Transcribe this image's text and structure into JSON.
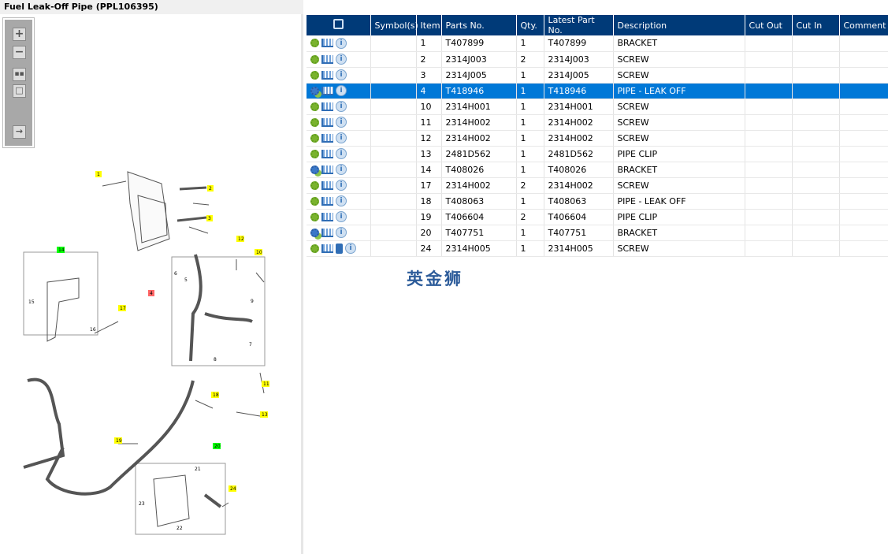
{
  "title": "Fuel Leak-Off Pipe (PPL106395)",
  "toolbar": {
    "zoom_in": "zoom-in",
    "zoom_out": "zoom-out",
    "fit": "fit-all",
    "reset": "actual-size",
    "export": "list-export"
  },
  "columns": [
    "",
    "Symbol(s)",
    "Item",
    "Parts No.",
    "Qty.",
    "Latest Part No.",
    "Description",
    "Cut Out",
    "Cut In",
    "Comment"
  ],
  "rows": [
    {
      "item": "1",
      "part": "T407899",
      "qty": "1",
      "latest": "T407899",
      "desc": "BRACKET",
      "icon": "green-gear"
    },
    {
      "item": "2",
      "part": "2314J003",
      "qty": "2",
      "latest": "2314J003",
      "desc": "SCREW",
      "icon": "green-gear"
    },
    {
      "item": "3",
      "part": "2314J005",
      "qty": "1",
      "latest": "2314J005",
      "desc": "SCREW",
      "icon": "green-gear"
    },
    {
      "item": "4",
      "part": "T418946",
      "qty": "1",
      "latest": "T418946",
      "desc": "PIPE - LEAK OFF",
      "icon": "blue-gear",
      "selected": true
    },
    {
      "item": "10",
      "part": "2314H001",
      "qty": "1",
      "latest": "2314H001",
      "desc": "SCREW",
      "icon": "green-gear"
    },
    {
      "item": "11",
      "part": "2314H002",
      "qty": "1",
      "latest": "2314H002",
      "desc": "SCREW",
      "icon": "green-gear"
    },
    {
      "item": "12",
      "part": "2314H002",
      "qty": "1",
      "latest": "2314H002",
      "desc": "SCREW",
      "icon": "green-gear"
    },
    {
      "item": "13",
      "part": "2481D562",
      "qty": "1",
      "latest": "2481D562",
      "desc": "PIPE CLIP",
      "icon": "green-gear"
    },
    {
      "item": "14",
      "part": "T408026",
      "qty": "1",
      "latest": "T408026",
      "desc": "BRACKET",
      "icon": "blue-gear"
    },
    {
      "item": "17",
      "part": "2314H002",
      "qty": "2",
      "latest": "2314H002",
      "desc": "SCREW",
      "icon": "green-gear"
    },
    {
      "item": "18",
      "part": "T408063",
      "qty": "1",
      "latest": "T408063",
      "desc": "PIPE - LEAK OFF",
      "icon": "green-gear"
    },
    {
      "item": "19",
      "part": "T406604",
      "qty": "2",
      "latest": "T406604",
      "desc": "PIPE CLIP",
      "icon": "green-gear"
    },
    {
      "item": "20",
      "part": "T407751",
      "qty": "1",
      "latest": "T407751",
      "desc": "BRACKET",
      "icon": "blue-gear"
    },
    {
      "item": "24",
      "part": "2314H005",
      "qty": "1",
      "latest": "2314H005",
      "desc": "SCREW",
      "icon": "green-gear",
      "doc": true
    }
  ],
  "watermark": "英金狮",
  "callouts": {
    "yellow": [
      "1",
      "2",
      "3",
      "12",
      "10",
      "17",
      "11",
      "18",
      "13",
      "19",
      "24"
    ],
    "green": [
      "14",
      "20"
    ],
    "red": [
      "4"
    ],
    "plain": [
      "6",
      "5",
      "15",
      "16",
      "9",
      "7",
      "8",
      "21",
      "23",
      "22"
    ]
  },
  "colors": {
    "header": "#003a78",
    "selected": "#0078d7",
    "yellow": "#ffff00",
    "green": "#00ff00",
    "red": "#ff6666"
  }
}
